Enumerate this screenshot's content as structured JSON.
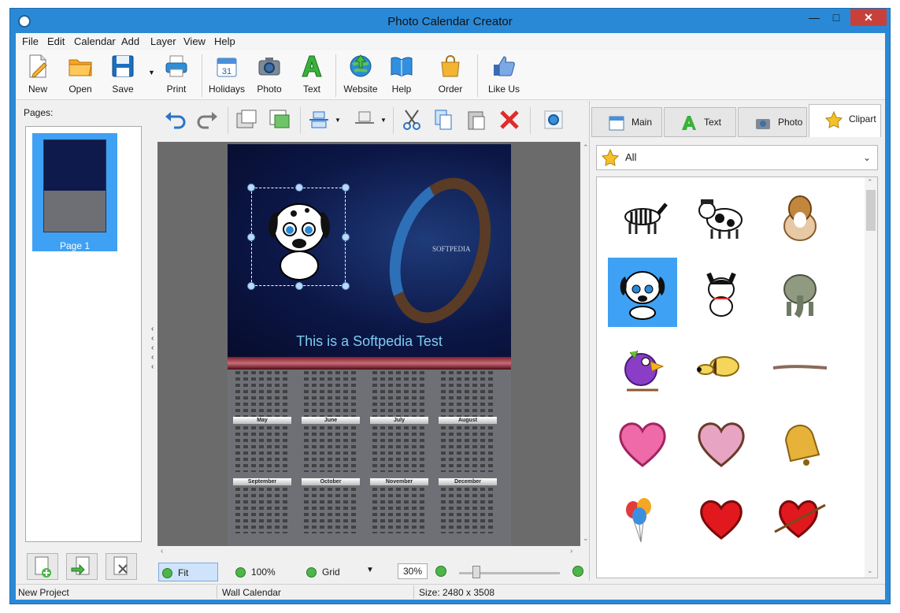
{
  "window": {
    "title": "Photo Calendar Creator"
  },
  "menu": [
    "File",
    "Edit",
    "Calendar",
    "Add",
    "Layer",
    "View",
    "Help"
  ],
  "toolbar": {
    "new": "New",
    "open": "Open",
    "save": "Save",
    "print": "Print",
    "holidays": "Holidays",
    "photo": "Photo",
    "text": "Text",
    "website": "Website",
    "help": "Help",
    "order": "Order",
    "like": "Like Us"
  },
  "pages": {
    "label": "Pages:",
    "page1": "Page 1"
  },
  "canvas": {
    "caption": "This is a Softpedia Test",
    "swirl_label": "SOFTPEDIA",
    "months": [
      "May",
      "June",
      "July",
      "August",
      "September",
      "October",
      "November",
      "December"
    ]
  },
  "zoombar": {
    "fit": "Fit",
    "hundred": "100%",
    "grid": "Grid",
    "zoom_value": "30%"
  },
  "right": {
    "tabs": {
      "main": "Main",
      "text": "Text",
      "photo": "Photo",
      "clipart": "Clipart"
    },
    "category": "All",
    "cliparts": [
      "zebra",
      "cow",
      "collie",
      "dalmatian-puppy",
      "husky",
      "elephant",
      "purple-bird",
      "beagle",
      "brush-stroke",
      "pink-heart",
      "glitter-heart",
      "bell",
      "balloons",
      "red-heart",
      "heart-arrow"
    ]
  },
  "status": {
    "project": "New Project",
    "type": "Wall Calendar",
    "size": "Size: 2480 x 3508"
  },
  "colors": {
    "accent": "#3ea1f4",
    "window_frame": "#2a89d6",
    "close": "#c7413a"
  }
}
